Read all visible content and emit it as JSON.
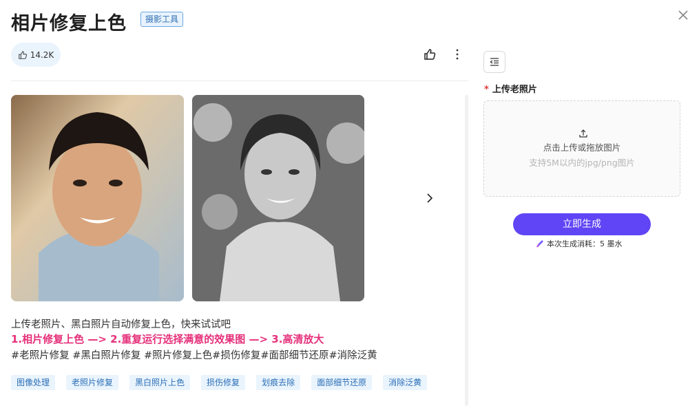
{
  "header": {
    "title": "相片修复上色",
    "tag": "摄影工具",
    "close_icon": "close-icon"
  },
  "stats": {
    "like_count": "14.2K"
  },
  "toolbar": {
    "thumb_icon": "thumbs-up-icon",
    "more_icon": "more-vertical-icon"
  },
  "gallery": {
    "images": [
      {
        "name": "young-man-color-photo"
      },
      {
        "name": "young-woman-bw-photo"
      }
    ],
    "next_icon": "chevron-right-icon"
  },
  "description": {
    "line1": "上传老照片、黑白照片自动修复上色，快来试试吧",
    "line2": "1.相片修复上色 —> 2.重复运行选择满意的效果图 —> 3.高清放大",
    "line3": "#老照片修复 #黑白照片修复 #照片修复上色#损伤修复#面部细节还原#消除泛黄"
  },
  "chips": [
    "图像处理",
    "老照片修复",
    "黑白照片上色",
    "损伤修复",
    "划痕去除",
    "面部细节还原",
    "消除泛黄"
  ],
  "form": {
    "required_mark": "*",
    "upload_label": "上传老照片",
    "upload_text": "点击上传或拖放图片",
    "upload_hint": "支持5M以内的jpg/png图片",
    "generate_label": "立即生成",
    "cost_text": "本次生成消耗：5 墨水"
  },
  "colors": {
    "accent": "#5f45f5",
    "highlight": "#e5307a",
    "chip_bg": "#eaf4fd",
    "chip_text": "#2a6eb5"
  }
}
